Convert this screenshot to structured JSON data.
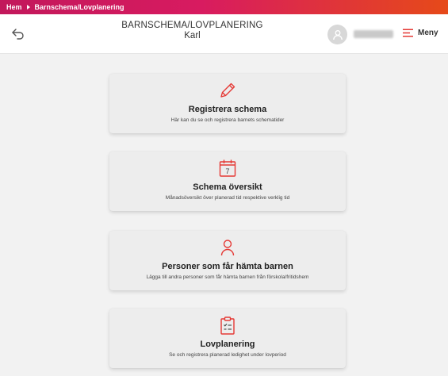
{
  "breadcrumb": {
    "home": "Hem",
    "current": "Barnschema/Lovplanering"
  },
  "header": {
    "title": "BARNSCHEMA/LOVPLANERING",
    "subtitle": "Karl",
    "menu_label": "Meny"
  },
  "cards": [
    {
      "icon": "pencil-icon",
      "title": "Registrera schema",
      "description": "Här kan du se och registrera barnets schematider"
    },
    {
      "icon": "calendar-icon",
      "calendar_day": "7",
      "title": "Schema översikt",
      "description": "Månadsöversikt över planerad tid respektive verklig tid"
    },
    {
      "icon": "person-icon",
      "title": "Personer som får hämta barnen",
      "description": "Lägga till andra personer som får hämta barnen från förskola/fritidshem"
    },
    {
      "icon": "clipboard-icon",
      "title": "Lovplanering",
      "description": "Se och registrera planerad ledighet under lovperiod"
    }
  ],
  "colors": {
    "accent": "#e53935",
    "banner_start": "#c2185b",
    "banner_end": "#e64a19"
  }
}
